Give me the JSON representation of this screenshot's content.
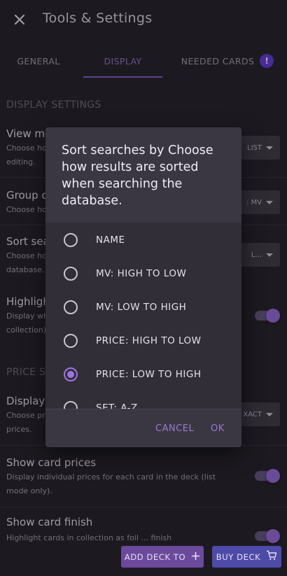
{
  "header": {
    "close_icon": "close-icon",
    "title": "Tools & Settings"
  },
  "tabs": [
    {
      "label": "GENERAL",
      "active": false
    },
    {
      "label": "DISPLAY",
      "active": true
    },
    {
      "label": "NEEDED CARDS",
      "active": false,
      "badge": "!"
    }
  ],
  "sections": {
    "display_settings": "DISPLAY SETTINGS",
    "price_settings": "PRICE SE"
  },
  "settings": {
    "view_mode": {
      "title": "View mo",
      "desc": "Choose hov\nediting.",
      "value": "LIST"
    },
    "group_cards": {
      "title": "Group ca",
      "desc": "Choose hov",
      "value": ": MV"
    },
    "sort_searches": {
      "title": "Sort sea",
      "desc": "Choose hov\ndatabase.",
      "value": "L..."
    },
    "highlight": {
      "title": "Highligh",
      "desc": "Display wh\ncollection)",
      "on": true
    },
    "display_price": {
      "title": "Display p",
      "desc": "Choose pri\nprices.",
      "value": "XACT"
    },
    "show_card_prices": {
      "title": "Show card prices",
      "desc": "Display individual prices for each card in the deck (list mode only).",
      "on": true
    },
    "show_card_finish": {
      "title": "Show card finish",
      "desc": "Highlight cards in collection as foil ... finish",
      "on": true
    }
  },
  "dialog": {
    "title": "Sort searches by Choose how results are sorted when searching the database.",
    "options": [
      {
        "label": "NAME",
        "selected": false
      },
      {
        "label": "MV: HIGH TO LOW",
        "selected": false
      },
      {
        "label": "MV: LOW TO HIGH",
        "selected": false
      },
      {
        "label": "PRICE: HIGH TO LOW",
        "selected": false
      },
      {
        "label": "PRICE: LOW TO HIGH",
        "selected": true
      },
      {
        "label": "SET: A-Z",
        "selected": false
      }
    ],
    "cancel_label": "CANCEL",
    "ok_label": "OK"
  },
  "bottom_bar": {
    "add_deck_label": "ADD DECK TO",
    "buy_deck_label": "BUY DECK"
  },
  "colors": {
    "accent": "#9c74e2",
    "background": "#2a2730",
    "dialog": "#3b3742"
  }
}
